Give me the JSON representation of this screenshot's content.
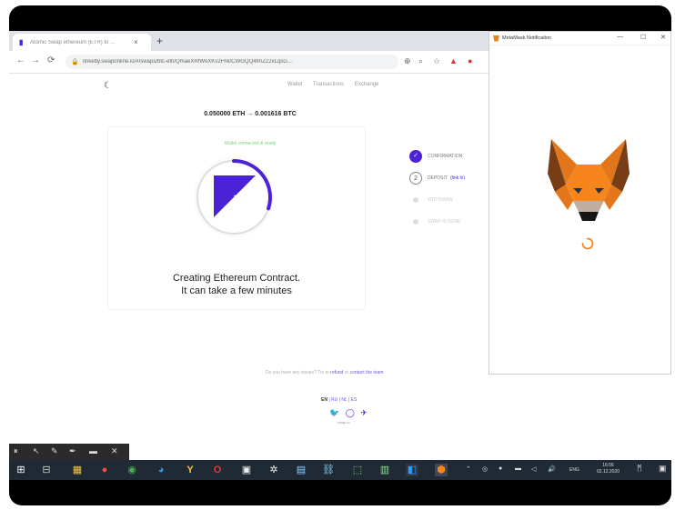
{
  "browser": {
    "tab_title": "Atomic Swap ethereum (ETH) to ...",
    "tab_close": "×",
    "new_tab": "+",
    "url": "rinkeby.swaponline.io/#/swaps/btc-eth/QmaeXRfWoXKv2Fhk/CWGQQ4fmZ22xLqsG...",
    "nav": {
      "back": "←",
      "forward": "→",
      "reload": "⟳",
      "lock": "🔒"
    }
  },
  "site": {
    "nav_items": [
      "Wallet",
      "Transactions",
      "Exchange"
    ],
    "pair": "0.050000 ETH → 0.001616 BTC",
    "status_line": "Wallet connected & ready",
    "caption_line1": "Creating Ethereum Contract.",
    "caption_line2": "It can take a few minutes",
    "steps": [
      {
        "label": "CONFIRMATION",
        "state": "done",
        "mark": "✓"
      },
      {
        "label": "DEPOSIT",
        "state": "active",
        "mark": "2",
        "link": "(link tx)"
      },
      {
        "label": "WITHDRAW",
        "state": "todo"
      },
      {
        "label": "SWAP IS DONE",
        "state": "todo"
      }
    ],
    "footnote_prefix": "Do you have any issues? Try to",
    "footnote_link1": "refund",
    "footnote_mid": "or",
    "footnote_link2": "contact the team",
    "lang_active": "EN",
    "lang_rest": "| RU | NL | ES",
    "social_icons": "🐦 ◯ ✈",
    "social_sub": "swap.io",
    "progress_fraction": 0.3
  },
  "metamask": {
    "title": "MetaMask Notification",
    "minimize": "—",
    "maximize": "☐",
    "close": "✕"
  },
  "editbar": {
    "pause": "⏸",
    "cursor": "↖",
    "pen": "✎",
    "marker": "✒",
    "eraser": "▬",
    "close": "✕"
  },
  "taskbar": {
    "start": "⊞",
    "apps": [
      "⊟",
      "▦",
      "●",
      "◉",
      "◕",
      "Y",
      "O",
      "▣",
      "✲",
      "▤",
      "⛓",
      "⬚",
      "▥",
      "◧",
      "⬢"
    ],
    "tray": [
      "⌃",
      "◎",
      "●",
      "▬",
      "◁",
      "🔊"
    ],
    "lang": "ENG",
    "time": "16:56",
    "date": "02.12.2020",
    "notif": "▣"
  },
  "colors": {
    "accent": "#4b22d6",
    "status": "#7ed07e",
    "fox": "#e8821e"
  }
}
